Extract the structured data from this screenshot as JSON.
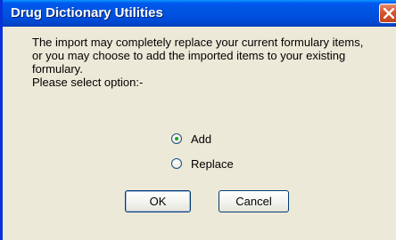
{
  "dialog": {
    "title": "Drug Dictionary Utilities",
    "close_icon": "close-icon",
    "message_lines": [
      "The import may completely replace your current formulary items,",
      "or you may choose to add the imported items to your existing",
      "formulary.",
      "Please select option:-"
    ],
    "options": [
      {
        "label": "Add",
        "checked": true
      },
      {
        "label": "Replace",
        "checked": false
      }
    ],
    "ok_label": "OK",
    "cancel_label": "Cancel"
  },
  "colors": {
    "titlebar": "#0053e0",
    "window_bg": "#ece9d8",
    "close_button": "#d7532b"
  }
}
